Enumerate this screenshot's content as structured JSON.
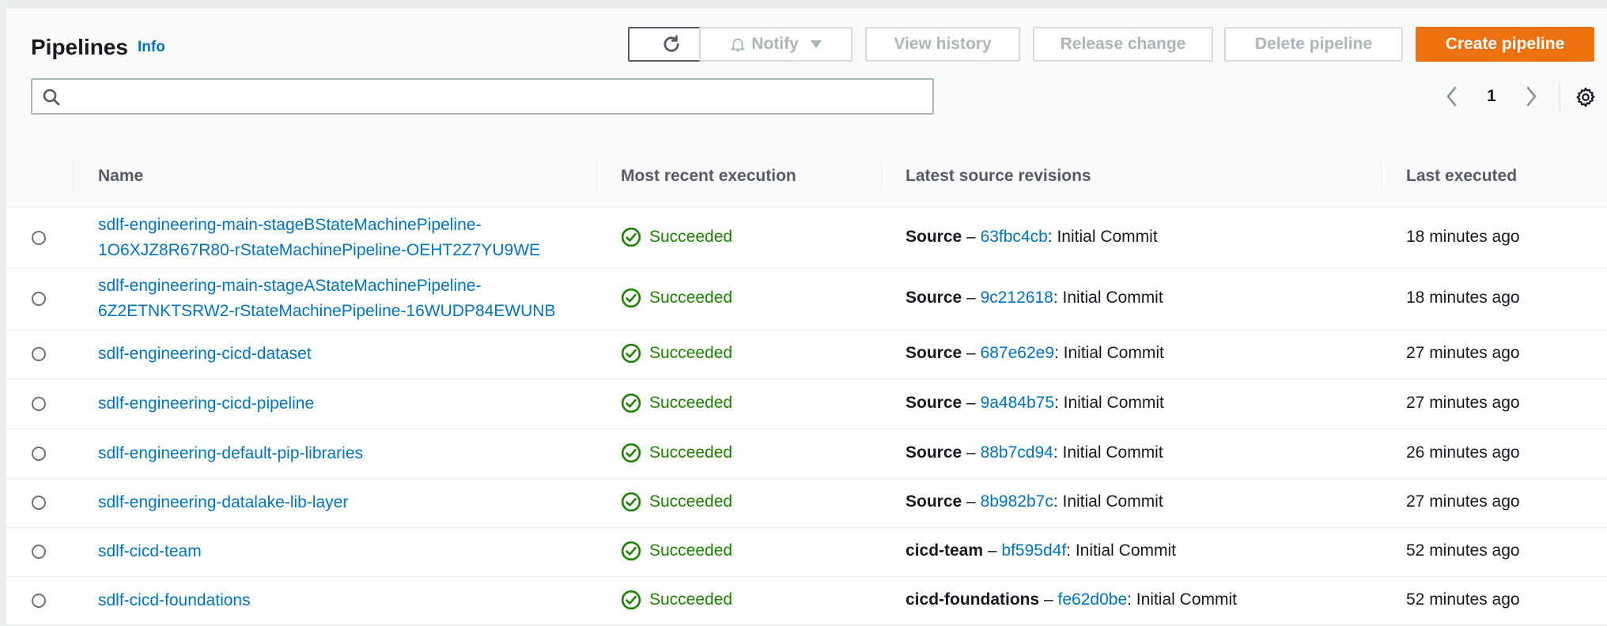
{
  "header": {
    "title": "Pipelines",
    "info_link": "Info"
  },
  "toolbar": {
    "refresh_icon": "refresh-icon",
    "notify_label": "Notify",
    "view_history_label": "View history",
    "release_change_label": "Release change",
    "delete_pipeline_label": "Delete pipeline",
    "create_pipeline_label": "Create pipeline"
  },
  "search": {
    "value": "",
    "placeholder": ""
  },
  "pagination": {
    "current_page": "1"
  },
  "table": {
    "columns": [
      "Name",
      "Most recent execution",
      "Latest source revisions",
      "Last executed"
    ],
    "rows": [
      {
        "name_line1": "sdlf-engineering-main-stageBStateMachinePipeline-",
        "name_line2": "1O6XJZ8R67R80-rStateMachinePipeline-OEHT2Z7YU9WE",
        "status": "Succeeded",
        "source": "Source",
        "sep": " – ",
        "commit": "63fbc4cb",
        "message": ": Initial Commit",
        "last_executed": "18 minutes ago"
      },
      {
        "name_line1": "sdlf-engineering-main-stageAStateMachinePipeline-",
        "name_line2": "6Z2ETNKTSRW2-rStateMachinePipeline-16WUDP84EWUNB",
        "status": "Succeeded",
        "source": "Source",
        "sep": " – ",
        "commit": "9c212618",
        "message": ": Initial Commit",
        "last_executed": "18 minutes ago"
      },
      {
        "name_line1": "sdlf-engineering-cicd-dataset",
        "name_line2": "",
        "status": "Succeeded",
        "source": "Source",
        "sep": " – ",
        "commit": "687e62e9",
        "message": ": Initial Commit",
        "last_executed": "27 minutes ago"
      },
      {
        "name_line1": "sdlf-engineering-cicd-pipeline",
        "name_line2": "",
        "status": "Succeeded",
        "source": "Source",
        "sep": " – ",
        "commit": "9a484b75",
        "message": ": Initial Commit",
        "last_executed": "27 minutes ago"
      },
      {
        "name_line1": "sdlf-engineering-default-pip-libraries",
        "name_line2": "",
        "status": "Succeeded",
        "source": "Source",
        "sep": " – ",
        "commit": "88b7cd94",
        "message": ": Initial Commit",
        "last_executed": "26 minutes ago"
      },
      {
        "name_line1": "sdlf-engineering-datalake-lib-layer",
        "name_line2": "",
        "status": "Succeeded",
        "source": "Source",
        "sep": " – ",
        "commit": "8b982b7c",
        "message": ": Initial Commit",
        "last_executed": "27 minutes ago"
      },
      {
        "name_line1": "sdlf-cicd-team",
        "name_line2": "",
        "status": "Succeeded",
        "source": "cicd-team",
        "sep": " – ",
        "commit": "bf595d4f",
        "message": ": Initial Commit",
        "last_executed": "52 minutes ago"
      },
      {
        "name_line1": "sdlf-cicd-foundations",
        "name_line2": "",
        "status": "Succeeded",
        "source": "cicd-foundations",
        "sep": " – ",
        "commit": "fe62d0be",
        "message": ": Initial Commit",
        "last_executed": "52 minutes ago"
      }
    ]
  },
  "colors": {
    "link": "#0073bb",
    "success": "#1d8102",
    "primary_button": "#ec7211",
    "disabled_text": "#aab7b8"
  }
}
